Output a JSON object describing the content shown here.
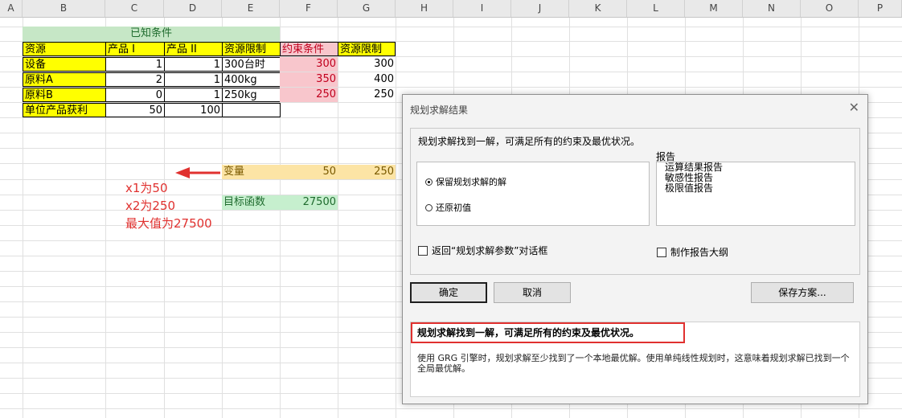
{
  "columns": [
    "A",
    "B",
    "C",
    "D",
    "E",
    "F",
    "G",
    "H",
    "I",
    "J",
    "K",
    "L",
    "M",
    "N",
    "O",
    "P"
  ],
  "sheet": {
    "title": "已知条件",
    "headers": [
      "资源",
      "产品 I",
      "产品 II",
      "资源限制",
      "约束条件",
      "资源限制"
    ],
    "rows": [
      {
        "name": "设备",
        "c": "1",
        "d": "1",
        "e": "300台时",
        "f": "300",
        "g": "300"
      },
      {
        "name": "原料A",
        "c": "2",
        "d": "1",
        "e": "400kg",
        "f": "350",
        "g": "400"
      },
      {
        "name": "原料B",
        "c": "0",
        "d": "1",
        "e": "250kg",
        "f": "250",
        "g": "250"
      },
      {
        "name": "单位产品获利",
        "c": "50",
        "d": "100",
        "e": "",
        "f": "",
        "g": ""
      }
    ],
    "variable_label": "变量",
    "var1": "50",
    "var2": "250",
    "objective_label": "目标函数",
    "objective_value": "27500"
  },
  "annotations": {
    "x1": "x1为50",
    "x2": "x2为250",
    "max": "最大值为27500"
  },
  "colors": {
    "annotation": "#e0312f",
    "highlight": "#e0312f"
  },
  "dialog": {
    "title": "规划求解结果",
    "close_icon": "close-icon",
    "message": "规划求解找到一解，可满足所有的约束及最优状况。",
    "radio_keep": "保留规划求解的解",
    "radio_restore": "还原初值",
    "report_label": "报告",
    "reports": [
      "运算结果报告",
      "敏感性报告",
      "极限值报告"
    ],
    "check_return": "返回“规划求解参数”对话框",
    "check_outline": "制作报告大纲",
    "ok": "确定",
    "cancel": "取消",
    "save": "保存方案...",
    "result_bold": "规划求解找到一解，可满足所有的约束及最优状况。",
    "result_desc": "使用 GRG 引擎时，规划求解至少找到了一个本地最优解。使用单纯线性规划时，这意味着规划求解已找到一个全局最优解。"
  }
}
